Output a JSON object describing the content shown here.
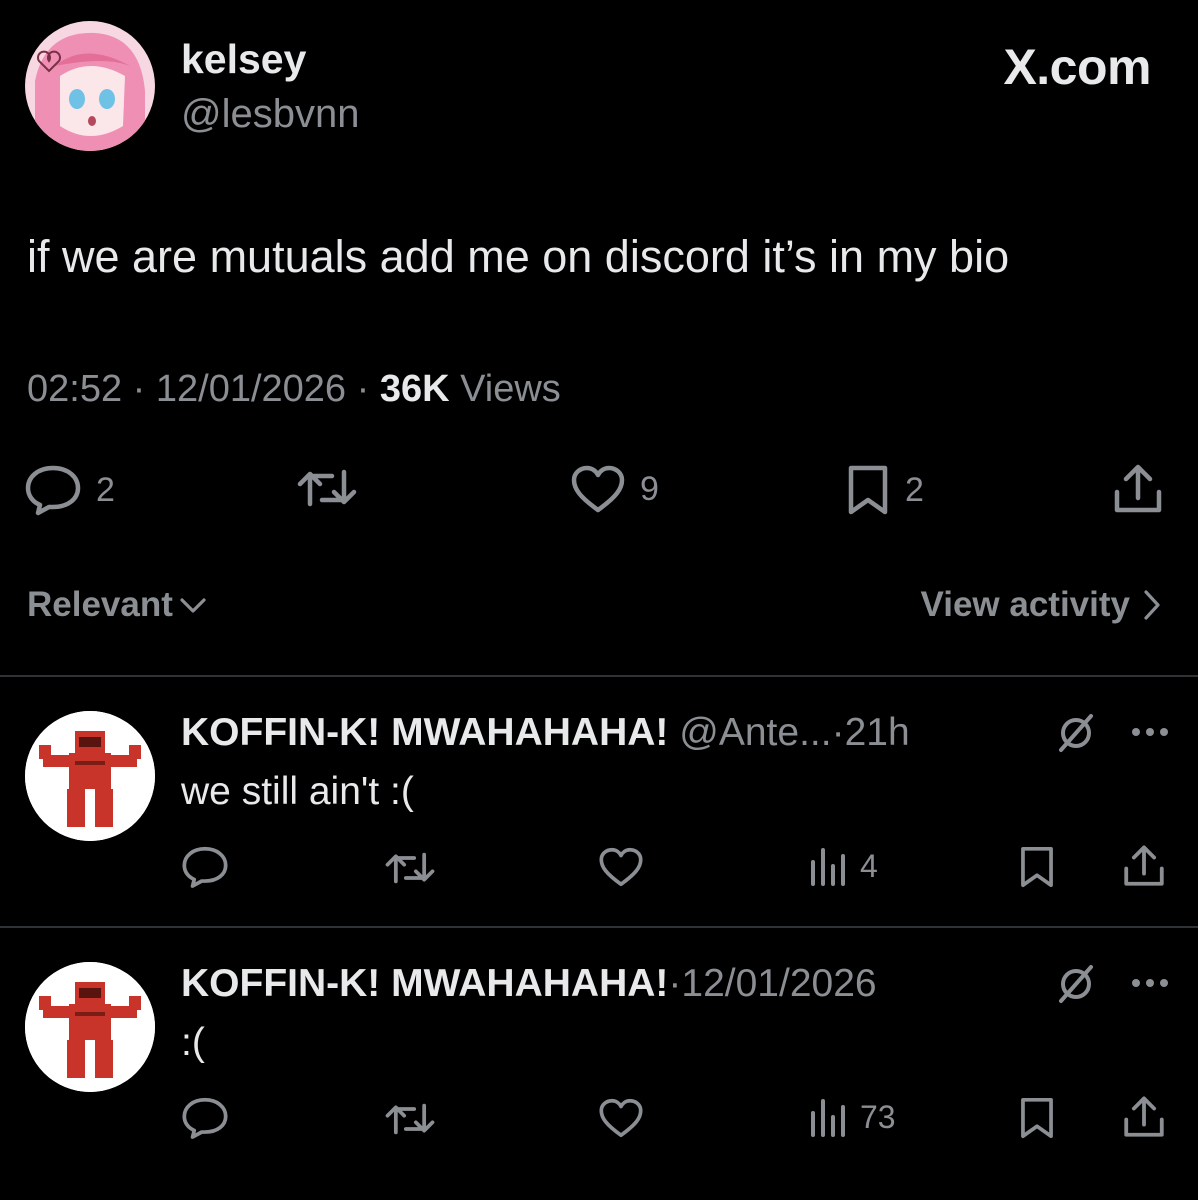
{
  "watermark": "X.com",
  "post": {
    "author": {
      "name": "kelsey",
      "handle": "@lesbvnn",
      "avatar_icon": "anime-avatar"
    },
    "text": "if we are mutuals add me on discord it’s in my bio",
    "time": "02:52",
    "date": "12/01/2026",
    "views_count": "36K",
    "views_label": "Views",
    "sep": "·",
    "actions": {
      "replies": "2",
      "reposts": "",
      "likes": "9",
      "bookmarks": "2"
    }
  },
  "replies_bar": {
    "sort_label": "Relevant",
    "view_activity_label": "View activity"
  },
  "replies": [
    {
      "name": "KOFFIN-K! MWAHAHAHA!",
      "handle": "@Ante...",
      "sep": "·",
      "time": "21h",
      "text": "we still ain't :(",
      "views": "4",
      "avatar_icon": "red-robot-avatar"
    },
    {
      "name": "KOFFIN-K! MWAHAHAHA!",
      "handle": "",
      "sep": "·",
      "time": "12/01/2026",
      "text": ":(",
      "views": "73",
      "avatar_icon": "red-robot-avatar"
    }
  ],
  "colors": {
    "background": "#000000",
    "text": "#e7e9ea",
    "muted": "#8b8f94",
    "divider": "#2f3336",
    "avatar_pink": "#f3a5c0",
    "robot_red": "#c8342a"
  }
}
